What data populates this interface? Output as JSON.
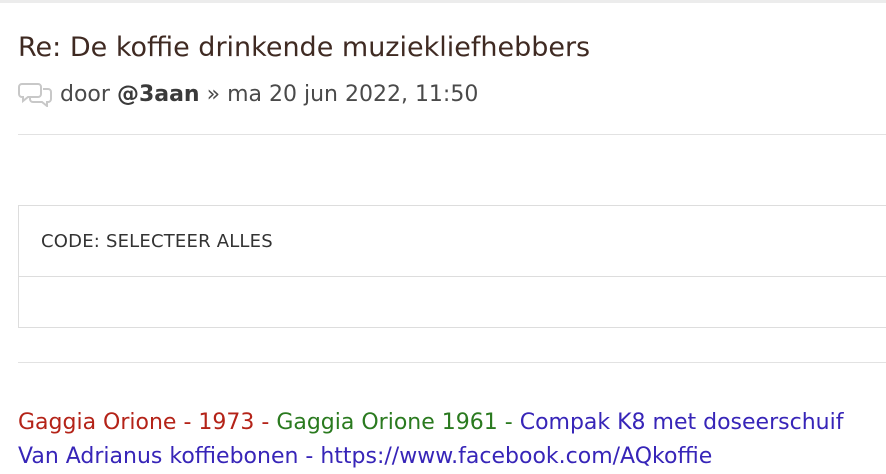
{
  "post": {
    "title": "Re: De koffie drinkende muziekliefhebbers",
    "meta": {
      "icon": "speech-bubbles-icon",
      "by_label": "door",
      "author": "@3aan",
      "separator": "»",
      "date": "ma 20 jun 2022, 11:50"
    }
  },
  "code_block": {
    "header_label": "CODE: SELECTEER ALLES",
    "content": ""
  },
  "signature": {
    "items": [
      {
        "text": "Gaggia Orione - 1973",
        "color": "#b42318"
      },
      {
        "text": " - ",
        "color": "#b42318"
      },
      {
        "text": "Gaggia Orione 1961",
        "color": "#2a7a1f"
      },
      {
        "text": " - ",
        "color": "#2a7a1f"
      },
      {
        "text": "Compak K8 met doseerschuif",
        "color": "#3725b8"
      }
    ],
    "second_line_partial": "Van Adrianus koffiebonen - https://www.facebook.com/AQkoffie"
  }
}
